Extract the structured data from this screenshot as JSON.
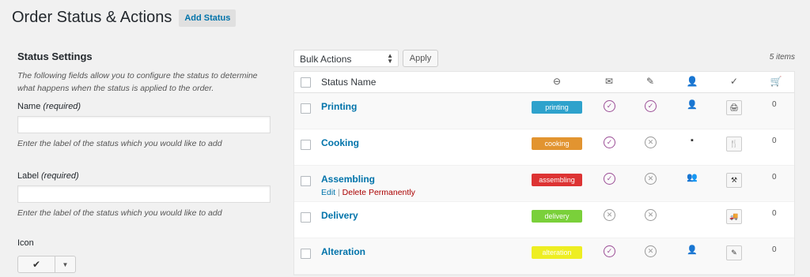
{
  "header": {
    "title": "Order Status & Actions",
    "add_button": "Add Status"
  },
  "settings": {
    "heading": "Status Settings",
    "description": "The following fields allow you to configure the status to determine what happens when the status is applied to the order.",
    "name_label": "Name",
    "name_required": "(required)",
    "name_value": "",
    "name_help": "Enter the label of the status which you would like to add",
    "label_label": "Label",
    "label_required": "(required)",
    "label_value": "",
    "label_help": "Enter the label of the status which you would like to add",
    "icon_label": "Icon",
    "icon_selected": "✔",
    "icon_dropdown": "▼"
  },
  "tablenav": {
    "bulk_actions": "Bulk Actions",
    "apply": "Apply",
    "items_count": "5 items"
  },
  "table": {
    "column_name": "Status Name",
    "column_icons": [
      "status-indicator-icon",
      "email-icon",
      "edit-pencil-icon",
      "user-icon",
      "checkmark-icon",
      "cart-icon"
    ],
    "rows": [
      {
        "name": "Printing",
        "badge": "printing",
        "badge_color": "#2ea2cc",
        "email": true,
        "editable": true,
        "user": "person",
        "action": "printer-icon",
        "count": "0"
      },
      {
        "name": "Cooking",
        "badge": "cooking",
        "badge_color": "#e29430",
        "email": true,
        "editable": false,
        "user": "id-card",
        "action": "cutlery-icon",
        "count": "0"
      },
      {
        "name": "Assembling",
        "badge": "assembling",
        "badge_color": "#dd3333",
        "email": true,
        "editable": false,
        "user": "group",
        "action": "tools-icon",
        "count": "0",
        "edit_label": "Edit",
        "separator": "|",
        "delete_label": "Delete Permanently"
      },
      {
        "name": "Delivery",
        "badge": "delivery",
        "badge_color": "#7ad03a",
        "email": false,
        "editable": false,
        "user": "",
        "action": "truck-icon",
        "count": "0"
      },
      {
        "name": "Alteration",
        "badge": "alteration",
        "badge_color": "#eeee22",
        "email": true,
        "editable": false,
        "user": "tie-person",
        "action": "pencil-icon",
        "count": "0"
      }
    ]
  },
  "colors": {
    "link": "#0073aa",
    "yes": "#9b4d96",
    "no": "#999999",
    "delete": "#aa0000"
  }
}
